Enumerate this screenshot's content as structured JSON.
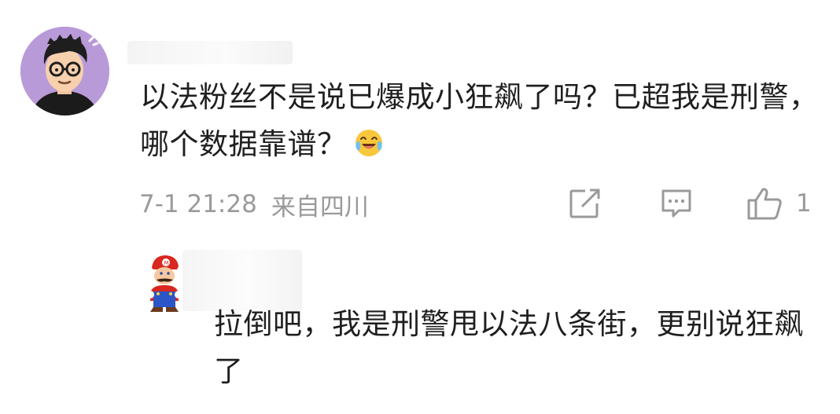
{
  "comment": {
    "text": "以法粉丝不是说已爆成小狂飙了吗？已超我是刑警，哪个数据靠谱？",
    "emoji": "laughing-crying-emoji",
    "time": "7-1 21:28",
    "location": "来自四川",
    "like_count": "1"
  },
  "reply": {
    "text": "拉倒吧，我是刑警甩以法八条街，更别说狂飙了"
  },
  "colors": {
    "avatar_bg": "#b99ad8",
    "meta_text": "#9a9a9a",
    "body_text": "#1f1f1f"
  },
  "icons": [
    "share-icon",
    "reply-icon",
    "like-icon"
  ]
}
